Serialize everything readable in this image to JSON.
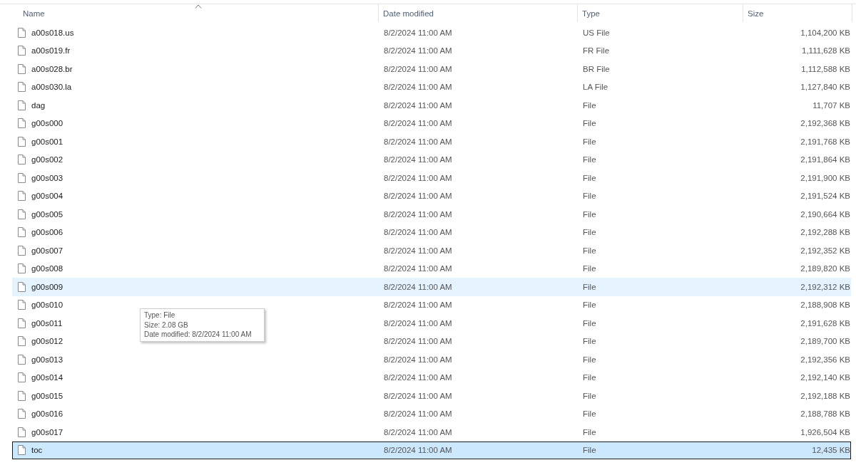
{
  "columns": [
    {
      "label": "Name",
      "sorted": true
    },
    {
      "label": "Date modified",
      "sorted": false
    },
    {
      "label": "Type",
      "sorted": false
    },
    {
      "label": "Size",
      "sorted": false
    }
  ],
  "rows": [
    {
      "name": "a00s018.us",
      "date": "8/2/2024 11:00 AM",
      "type": "US File",
      "size": "1,104,200 KB",
      "hovered": false,
      "selected": false
    },
    {
      "name": "a00s019.fr",
      "date": "8/2/2024 11:00 AM",
      "type": "FR File",
      "size": "1,111,628 KB",
      "hovered": false,
      "selected": false
    },
    {
      "name": "a00s028.br",
      "date": "8/2/2024 11:00 AM",
      "type": "BR File",
      "size": "1,112,588 KB",
      "hovered": false,
      "selected": false
    },
    {
      "name": "a00s030.la",
      "date": "8/2/2024 11:00 AM",
      "type": "LA File",
      "size": "1,127,840 KB",
      "hovered": false,
      "selected": false
    },
    {
      "name": "dag",
      "date": "8/2/2024 11:00 AM",
      "type": "File",
      "size": "11,707 KB",
      "hovered": false,
      "selected": false
    },
    {
      "name": "g00s000",
      "date": "8/2/2024 11:00 AM",
      "type": "File",
      "size": "2,192,368 KB",
      "hovered": false,
      "selected": false
    },
    {
      "name": "g00s001",
      "date": "8/2/2024 11:00 AM",
      "type": "File",
      "size": "2,191,768 KB",
      "hovered": false,
      "selected": false
    },
    {
      "name": "g00s002",
      "date": "8/2/2024 11:00 AM",
      "type": "File",
      "size": "2,191,864 KB",
      "hovered": false,
      "selected": false
    },
    {
      "name": "g00s003",
      "date": "8/2/2024 11:00 AM",
      "type": "File",
      "size": "2,191,900 KB",
      "hovered": false,
      "selected": false
    },
    {
      "name": "g00s004",
      "date": "8/2/2024 11:00 AM",
      "type": "File",
      "size": "2,191,524 KB",
      "hovered": false,
      "selected": false
    },
    {
      "name": "g00s005",
      "date": "8/2/2024 11:00 AM",
      "type": "File",
      "size": "2,190,664 KB",
      "hovered": false,
      "selected": false
    },
    {
      "name": "g00s006",
      "date": "8/2/2024 11:00 AM",
      "type": "File",
      "size": "2,192,288 KB",
      "hovered": false,
      "selected": false
    },
    {
      "name": "g00s007",
      "date": "8/2/2024 11:00 AM",
      "type": "File",
      "size": "2,192,352 KB",
      "hovered": false,
      "selected": false
    },
    {
      "name": "g00s008",
      "date": "8/2/2024 11:00 AM",
      "type": "File",
      "size": "2,189,820 KB",
      "hovered": false,
      "selected": false
    },
    {
      "name": "g00s009",
      "date": "8/2/2024 11:00 AM",
      "type": "File",
      "size": "2,192,312 KB",
      "hovered": true,
      "selected": false
    },
    {
      "name": "g00s010",
      "date": "8/2/2024 11:00 AM",
      "type": "File",
      "size": "2,188,908 KB",
      "hovered": false,
      "selected": false
    },
    {
      "name": "g00s011",
      "date": "8/2/2024 11:00 AM",
      "type": "File",
      "size": "2,191,628 KB",
      "hovered": false,
      "selected": false
    },
    {
      "name": "g00s012",
      "date": "8/2/2024 11:00 AM",
      "type": "File",
      "size": "2,189,700 KB",
      "hovered": false,
      "selected": false
    },
    {
      "name": "g00s013",
      "date": "8/2/2024 11:00 AM",
      "type": "File",
      "size": "2,192,356 KB",
      "hovered": false,
      "selected": false
    },
    {
      "name": "g00s014",
      "date": "8/2/2024 11:00 AM",
      "type": "File",
      "size": "2,192,140 KB",
      "hovered": false,
      "selected": false
    },
    {
      "name": "g00s015",
      "date": "8/2/2024 11:00 AM",
      "type": "File",
      "size": "2,192,188 KB",
      "hovered": false,
      "selected": false
    },
    {
      "name": "g00s016",
      "date": "8/2/2024 11:00 AM",
      "type": "File",
      "size": "2,188,788 KB",
      "hovered": false,
      "selected": false
    },
    {
      "name": "g00s017",
      "date": "8/2/2024 11:00 AM",
      "type": "File",
      "size": "1,926,504 KB",
      "hovered": false,
      "selected": false
    },
    {
      "name": "toc",
      "date": "8/2/2024 11:00 AM",
      "type": "File",
      "size": "12,435 KB",
      "hovered": false,
      "selected": true
    }
  ],
  "tooltip": {
    "lines": [
      "Type: File",
      "Size: 2.08 GB",
      "Date modified: 8/2/2024 11:00 AM"
    ]
  }
}
